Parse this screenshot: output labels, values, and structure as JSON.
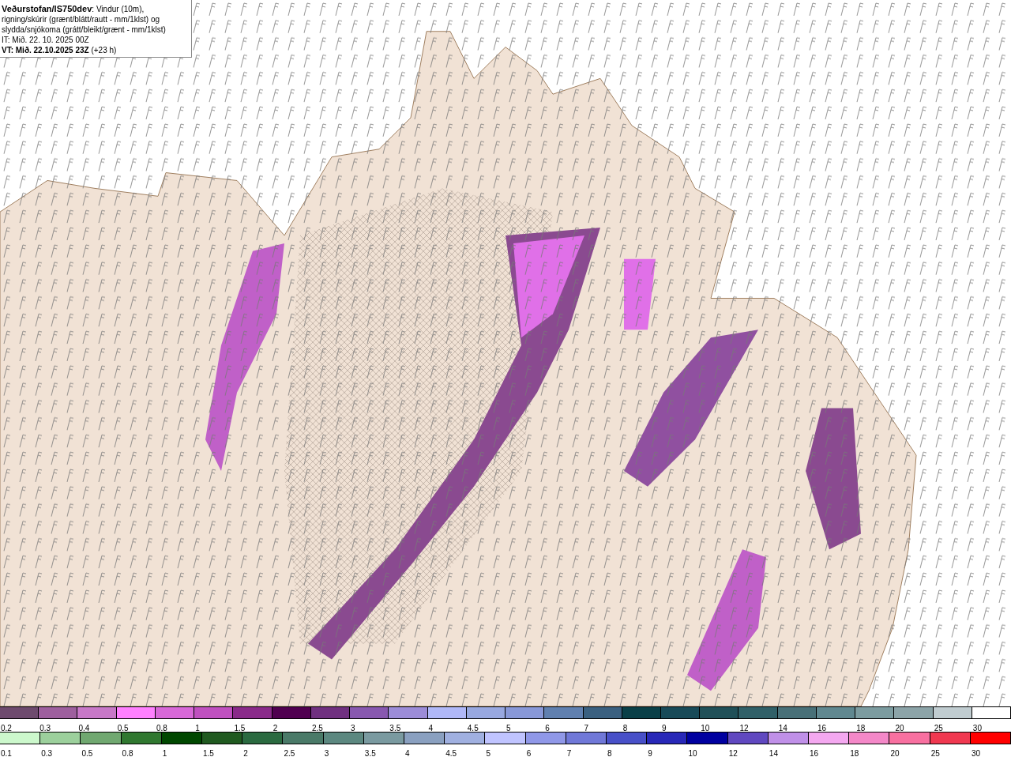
{
  "header": {
    "source": "Veðurstofan/IS750dev",
    "description": ": Vindur (10m), rigning/skúrir (grænt/blátt/rautt - mm/1klst) og slydda/snjókoma (grátt/bleikt/grænt - mm/1klst)",
    "issue_time": "IT: Mið. 22. 10. 2025 00Z",
    "valid_time": "Mið. 22.10.2025 23Z",
    "valid_prefix": "VT: ",
    "lead": " (+23 h)"
  },
  "legends": [
    {
      "items": [
        {
          "label": "0.2",
          "color": "#6e4a6e"
        },
        {
          "label": "0.3",
          "color": "#9e5f9e"
        },
        {
          "label": "0.4",
          "color": "#c878c8"
        },
        {
          "label": "0.5",
          "color": "#ff80ff"
        },
        {
          "label": "0.8",
          "color": "#d868d8"
        },
        {
          "label": "1",
          "color": "#c050c0"
        },
        {
          "label": "1.5",
          "color": "#8a2a8a"
        },
        {
          "label": "2",
          "color": "#500050"
        },
        {
          "label": "2.5",
          "color": "#703080"
        },
        {
          "label": "3",
          "color": "#8858b0"
        },
        {
          "label": "3.5",
          "color": "#9c8cd8"
        },
        {
          "label": "4",
          "color": "#b0b8f8"
        },
        {
          "label": "4.5",
          "color": "#98a8e0"
        },
        {
          "label": "5",
          "color": "#8898d8"
        },
        {
          "label": "6",
          "color": "#6080b0"
        },
        {
          "label": "7",
          "color": "#3a6080"
        },
        {
          "label": "8",
          "color": "#0a4048"
        },
        {
          "label": "9",
          "color": "#184a58"
        },
        {
          "label": "10",
          "color": "#205058"
        },
        {
          "label": "12",
          "color": "#306068"
        },
        {
          "label": "14",
          "color": "#487078"
        },
        {
          "label": "16",
          "color": "#608890"
        },
        {
          "label": "18",
          "color": "#7c9ca0"
        },
        {
          "label": "20",
          "color": "#8ca4a8"
        },
        {
          "label": "25",
          "color": "#c0ccd0"
        },
        {
          "label": "30",
          "color": "#ffffff"
        }
      ]
    },
    {
      "items": [
        {
          "label": "0.1",
          "color": "#ccf8cc"
        },
        {
          "label": "0.3",
          "color": "#9cd09c"
        },
        {
          "label": "0.5",
          "color": "#70a870"
        },
        {
          "label": "0.8",
          "color": "#307830"
        },
        {
          "label": "1",
          "color": "#004800"
        },
        {
          "label": "1.5",
          "color": "#205a20"
        },
        {
          "label": "2",
          "color": "#2a6a40"
        },
        {
          "label": "2.5",
          "color": "#4a7a68"
        },
        {
          "label": "3",
          "color": "#5c8880"
        },
        {
          "label": "3.5",
          "color": "#7a9aa0"
        },
        {
          "label": "4",
          "color": "#8aa0c0"
        },
        {
          "label": "4.5",
          "color": "#a0b0e0"
        },
        {
          "label": "5",
          "color": "#c0c4ff"
        },
        {
          "label": "6",
          "color": "#9098e8"
        },
        {
          "label": "7",
          "color": "#7078d8"
        },
        {
          "label": "8",
          "color": "#4850c8"
        },
        {
          "label": "9",
          "color": "#2828b8"
        },
        {
          "label": "10",
          "color": "#0000a0"
        },
        {
          "label": "12",
          "color": "#6048c0"
        },
        {
          "label": "14",
          "color": "#c090e8"
        },
        {
          "label": "16",
          "color": "#f4a8f0"
        },
        {
          "label": "18",
          "color": "#f488c8"
        },
        {
          "label": "20",
          "color": "#f870a0"
        },
        {
          "label": "25",
          "color": "#f03850"
        },
        {
          "label": "30",
          "color": "#ff0000"
        }
      ]
    }
  ]
}
